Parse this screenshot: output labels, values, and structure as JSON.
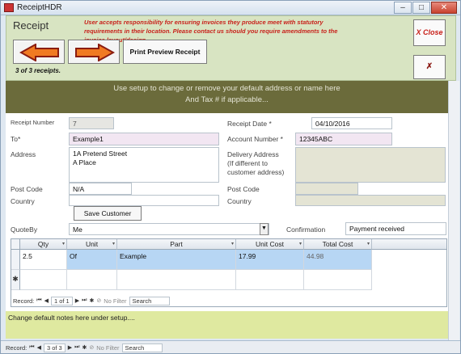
{
  "window": {
    "title": "ReceiptHDR",
    "min_glyph": "–",
    "max_glyph": "□",
    "close_glyph": "✕"
  },
  "header": {
    "title": "Receipt",
    "disclaimer": "User accepts responsibility for ensuring invoices they produce meet with statutory requirements in their location. Please contact us should you require amendments to the invoice layout/design...",
    "print_preview_label": "Print Preview Receipt",
    "record_count": "3 of 3 receipts.",
    "xclose_label": "X Close",
    "delete_label": "✗"
  },
  "banner": {
    "line1": "Use setup to change or remove your default address or name here",
    "line2": "And Tax # if applicable..."
  },
  "form": {
    "receipt_number_label": "Receipt Number",
    "receipt_number": "7",
    "receipt_date_label": "Receipt Date *",
    "receipt_date": "04/10/2016",
    "to_label": "To*",
    "to_value": "Example1",
    "account_number_label": "Account Number *",
    "account_number": "12345ABC",
    "address_label": "Address",
    "address_line1": "1A Pretend Street",
    "address_line2": "A Place",
    "delivery_address_label_1": "Delivery Address",
    "delivery_address_label_2": "(If different to",
    "delivery_address_label_3": "customer address)",
    "post_code_label": "Post Code",
    "post_code": "N/A",
    "country_label": "Country",
    "delivery_post_code_label": "Post Code",
    "delivery_country_label": "Country",
    "save_customer_label": "Save Customer",
    "quote_by_label": "QuoteBy",
    "quote_by": "Me",
    "confirmation_label": "Confirmation",
    "confirmation": "Payment received"
  },
  "grid": {
    "headers": [
      "Qty",
      "Unit",
      "Part",
      "Unit Cost",
      "Total Cost"
    ],
    "rows": [
      {
        "qty": "2.5",
        "unit": "Of",
        "part": "Example",
        "unit_cost": "17.99",
        "total_cost": "44.98"
      }
    ],
    "new_row_marker": "✱",
    "nav": {
      "label": "Record:",
      "position": "1 of 1",
      "filter": "No Filter",
      "search": "Search"
    }
  },
  "notes": {
    "text": "Change default notes here under setup...."
  },
  "bottom_nav": {
    "label": "Record:",
    "position": "3 of 3",
    "filter": "No Filter",
    "search": "Search"
  }
}
